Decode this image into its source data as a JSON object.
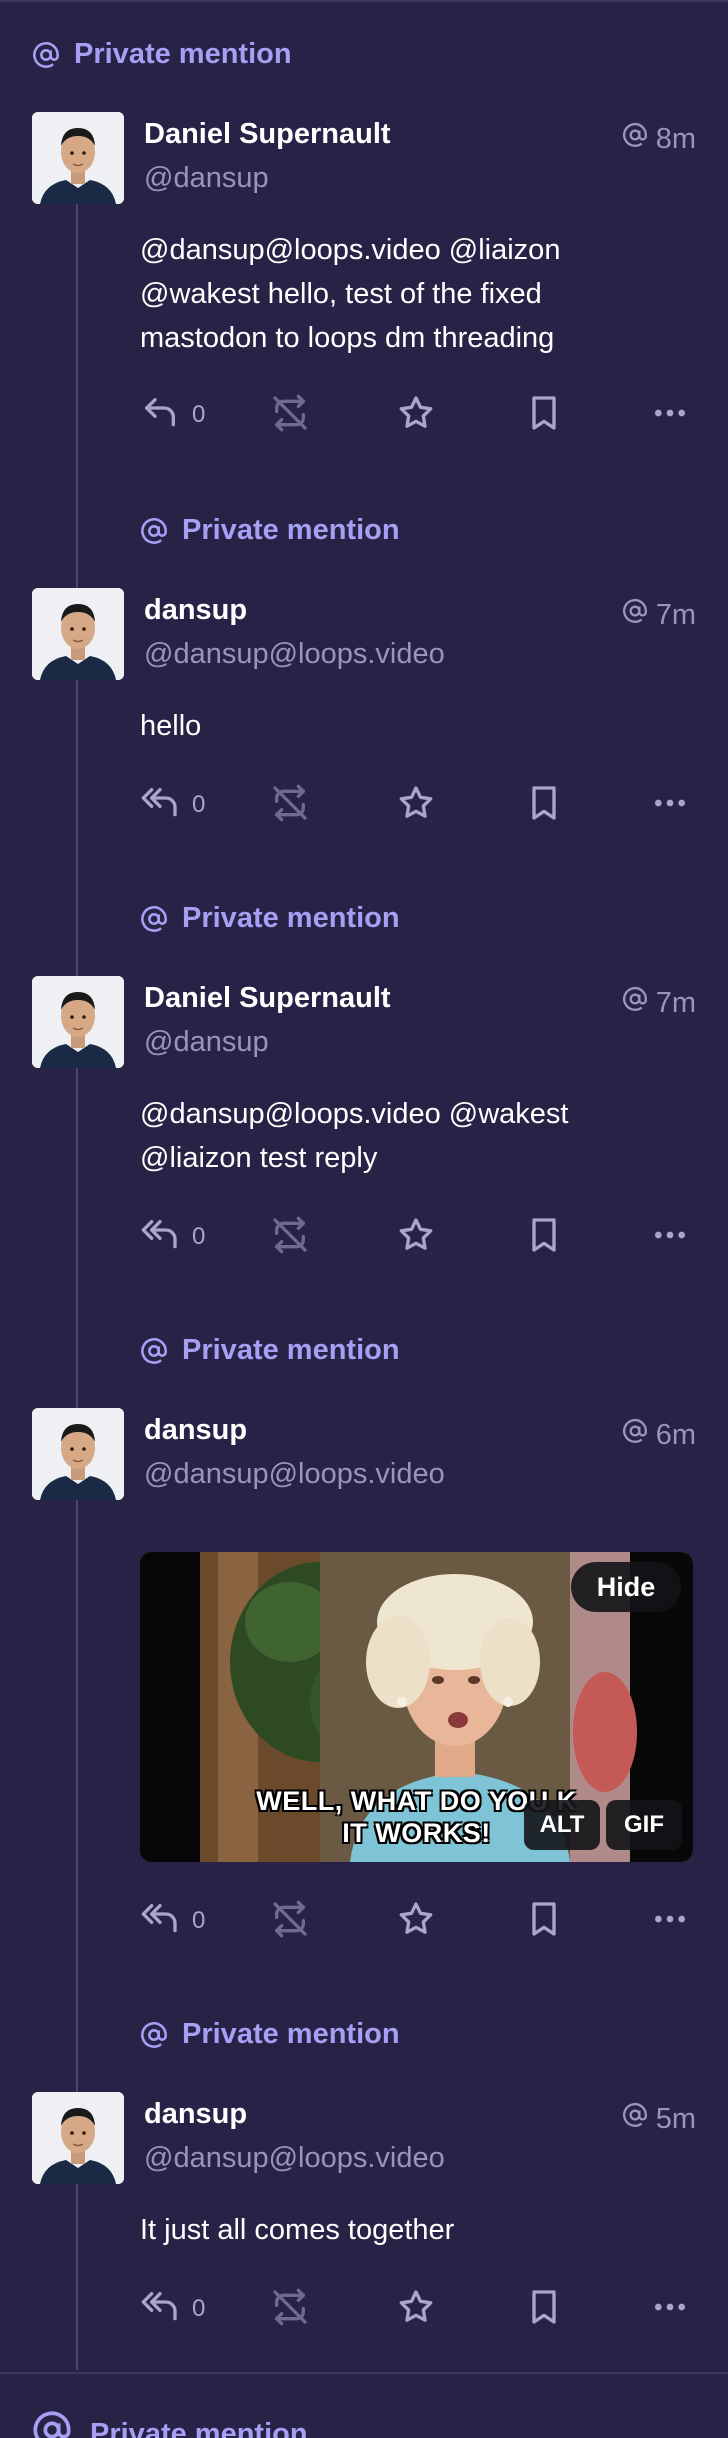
{
  "colors": {
    "background": "#282246",
    "accent": "#a6a0f4",
    "muted": "#9994b8",
    "text": "#ffffff"
  },
  "posts": [
    {
      "mention_label": "Private mention",
      "display_name": "Daniel Supernault",
      "handle": "@dansup",
      "time": "8m",
      "content_lines": [
        "@dansup@loops.video @liaizon",
        "@wakest hello, test of the fixed",
        "mastodon to loops dm threading"
      ],
      "reply_icon": "reply-icon",
      "reply_count": "0"
    },
    {
      "mention_label": "Private mention",
      "display_name": "dansup",
      "handle": "@dansup@loops.video",
      "time": "7m",
      "content_lines": [
        "hello"
      ],
      "reply_icon": "reply-all-icon",
      "reply_count": "0"
    },
    {
      "mention_label": "Private mention",
      "display_name": "Daniel Supernault",
      "handle": "@dansup",
      "time": "7m",
      "content_lines": [
        "@dansup@loops.video @wakest",
        "@liaizon test reply"
      ],
      "reply_icon": "reply-all-icon",
      "reply_count": "0"
    },
    {
      "mention_label": "Private mention",
      "display_name": "dansup",
      "handle": "@dansup@loops.video",
      "time": "6m",
      "media": {
        "caption_line1": "WELL, WHAT DO YOU K",
        "caption_line2": "IT WORKS!",
        "hide_label": "Hide",
        "alt_label": "ALT",
        "gif_label": "GIF"
      },
      "reply_icon": "reply-all-icon",
      "reply_count": "0"
    },
    {
      "mention_label": "Private mention",
      "display_name": "dansup",
      "handle": "@dansup@loops.video",
      "time": "5m",
      "content_lines": [
        "It just all comes together"
      ],
      "reply_icon": "reply-all-icon",
      "reply_count": "0"
    }
  ],
  "partial_mention_label": "Private mention"
}
